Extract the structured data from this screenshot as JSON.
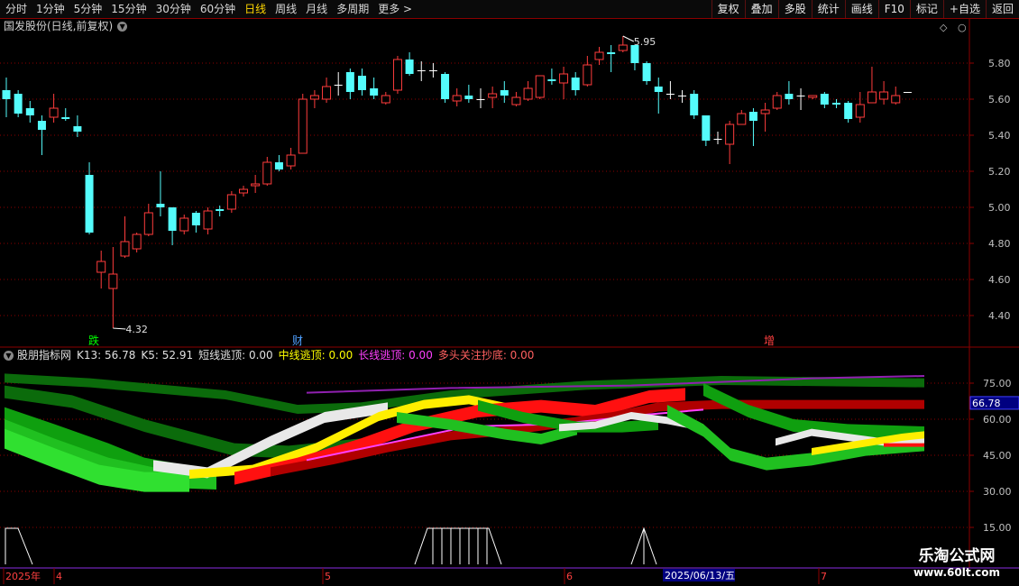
{
  "toolbar": {
    "periods": [
      {
        "label": "分时",
        "active": false
      },
      {
        "label": "1分钟",
        "active": false
      },
      {
        "label": "5分钟",
        "active": false
      },
      {
        "label": "15分钟",
        "active": false
      },
      {
        "label": "30分钟",
        "active": false
      },
      {
        "label": "60分钟",
        "active": false
      },
      {
        "label": "日线",
        "active": true
      },
      {
        "label": "周线",
        "active": false
      },
      {
        "label": "月线",
        "active": false
      },
      {
        "label": "多周期",
        "active": false
      },
      {
        "label": "更多",
        "active": false
      }
    ],
    "actions": [
      "复权",
      "叠加",
      "多股",
      "统计",
      "画线",
      "F10",
      "标记",
      "+自选",
      "返回"
    ]
  },
  "main_chart": {
    "title": "国发股份(日线,前复权)",
    "y_ticks": [
      "5.80",
      "5.60",
      "5.40",
      "5.20",
      "5.00",
      "4.80",
      "4.60",
      "4.40"
    ],
    "high_label": "5.95",
    "low_label": "4.32",
    "markers": [
      {
        "text": "跌",
        "color": "#00ff00"
      },
      {
        "text": "财",
        "color": "#4fa0ff"
      },
      {
        "text": "增",
        "color": "#ff4040"
      }
    ],
    "candles": [
      [
        5.65,
        5.6,
        5.72,
        5.5
      ],
      [
        5.63,
        5.52,
        5.65,
        5.5
      ],
      [
        5.55,
        5.51,
        5.59,
        5.47
      ],
      [
        5.48,
        5.43,
        5.51,
        5.29
      ],
      [
        5.5,
        5.55,
        5.63,
        5.47
      ],
      [
        5.5,
        5.49,
        5.55,
        5.48
      ],
      [
        5.45,
        5.42,
        5.51,
        5.39
      ],
      [
        5.18,
        4.86,
        5.25,
        4.85
      ],
      [
        4.64,
        4.7,
        4.76,
        4.55
      ],
      [
        4.55,
        4.63,
        4.78,
        4.33
      ],
      [
        4.73,
        4.81,
        4.95,
        4.72
      ],
      [
        4.77,
        4.85,
        4.86,
        4.75
      ],
      [
        4.85,
        4.97,
        5.02,
        4.84
      ],
      [
        5.02,
        5.0,
        5.2,
        4.95
      ],
      [
        5.0,
        4.87,
        5.0,
        4.79
      ],
      [
        4.87,
        4.94,
        4.96,
        4.85
      ],
      [
        4.97,
        4.9,
        4.98,
        4.86
      ],
      [
        4.88,
        4.98,
        5.0,
        4.85
      ],
      [
        4.99,
        4.98,
        5.01,
        4.95
      ],
      [
        4.99,
        5.07,
        5.09,
        4.97
      ],
      [
        5.08,
        5.1,
        5.12,
        5.06
      ],
      [
        5.12,
        5.13,
        5.18,
        5.08
      ],
      [
        5.13,
        5.25,
        5.28,
        5.12
      ],
      [
        5.25,
        5.21,
        5.29,
        5.2
      ],
      [
        5.23,
        5.29,
        5.33,
        5.21
      ],
      [
        5.3,
        5.6,
        5.63,
        5.3
      ],
      [
        5.6,
        5.62,
        5.65,
        5.55
      ],
      [
        5.6,
        5.67,
        5.72,
        5.58
      ],
      [
        5.68,
        5.68,
        5.75,
        5.62
      ],
      [
        5.75,
        5.64,
        5.77,
        5.6
      ],
      [
        5.73,
        5.65,
        5.77,
        5.62
      ],
      [
        5.66,
        5.62,
        5.72,
        5.6
      ],
      [
        5.58,
        5.62,
        5.64,
        5.57
      ],
      [
        5.65,
        5.82,
        5.84,
        5.63
      ],
      [
        5.82,
        5.74,
        5.86,
        5.73
      ],
      [
        5.76,
        5.76,
        5.81,
        5.7
      ],
      [
        5.76,
        5.76,
        5.8,
        5.72
      ],
      [
        5.74,
        5.6,
        5.75,
        5.58
      ],
      [
        5.59,
        5.62,
        5.66,
        5.56
      ],
      [
        5.62,
        5.6,
        5.68,
        5.58
      ],
      [
        5.6,
        5.6,
        5.66,
        5.55
      ],
      [
        5.61,
        5.63,
        5.67,
        5.55
      ],
      [
        5.65,
        5.62,
        5.7,
        5.58
      ],
      [
        5.57,
        5.61,
        5.64,
        5.56
      ],
      [
        5.6,
        5.66,
        5.7,
        5.59
      ],
      [
        5.61,
        5.73,
        5.73,
        5.6
      ],
      [
        5.71,
        5.7,
        5.77,
        5.68
      ],
      [
        5.69,
        5.74,
        5.78,
        5.6
      ],
      [
        5.72,
        5.65,
        5.75,
        5.62
      ],
      [
        5.68,
        5.79,
        5.84,
        5.67
      ],
      [
        5.82,
        5.86,
        5.89,
        5.79
      ],
      [
        5.86,
        5.85,
        5.9,
        5.75
      ],
      [
        5.87,
        5.9,
        5.95,
        5.86
      ],
      [
        5.9,
        5.8,
        5.9,
        5.76
      ],
      [
        5.8,
        5.7,
        5.81,
        5.68
      ],
      [
        5.67,
        5.64,
        5.72,
        5.52
      ],
      [
        5.63,
        5.63,
        5.7,
        5.6
      ],
      [
        5.62,
        5.62,
        5.65,
        5.58
      ],
      [
        5.63,
        5.51,
        5.65,
        5.49
      ],
      [
        5.51,
        5.37,
        5.51,
        5.34
      ],
      [
        5.38,
        5.38,
        5.42,
        5.35
      ],
      [
        5.35,
        5.46,
        5.48,
        5.24
      ],
      [
        5.46,
        5.52,
        5.54,
        5.46
      ],
      [
        5.53,
        5.48,
        5.55,
        5.34
      ],
      [
        5.52,
        5.54,
        5.58,
        5.42
      ],
      [
        5.55,
        5.62,
        5.64,
        5.54
      ],
      [
        5.63,
        5.6,
        5.7,
        5.57
      ],
      [
        5.62,
        5.62,
        5.66,
        5.54
      ],
      [
        5.61,
        5.62,
        5.62,
        5.6
      ],
      [
        5.63,
        5.57,
        5.64,
        5.55
      ],
      [
        5.58,
        5.57,
        5.6,
        5.55
      ],
      [
        5.58,
        5.49,
        5.59,
        5.47
      ],
      [
        5.5,
        5.57,
        5.64,
        5.47
      ],
      [
        5.58,
        5.64,
        5.78,
        5.58
      ],
      [
        5.6,
        5.64,
        5.7,
        5.57
      ],
      [
        5.58,
        5.62,
        5.67,
        5.57
      ],
      [
        5.64,
        5.64,
        5.64,
        5.64
      ]
    ]
  },
  "indicator": {
    "name": "股朋指标网",
    "params": [
      {
        "text": "K13: 56.78",
        "color": "#e0e0e0"
      },
      {
        "text": "K5: 52.91",
        "color": "#e0e0e0"
      },
      {
        "text": "短线逃顶: 0.00",
        "color": "#e0e0e0"
      },
      {
        "text": "中线逃顶: 0.00",
        "color": "#ffff00"
      },
      {
        "text": "长线逃顶: 0.00",
        "color": "#ff40ff"
      },
      {
        "text": "多头关注抄底: 0.00",
        "color": "#ff6060"
      }
    ],
    "y_ticks": [
      "75.00",
      "60.00",
      "45.00",
      "30.00",
      "15.00"
    ],
    "current_value": "66.78"
  },
  "time_axis": {
    "labels": [
      "2025年",
      "4",
      "5",
      "6",
      "7"
    ],
    "cursor_date": "2025/06/13/五"
  },
  "watermark": {
    "line1": "乐淘公式网",
    "line2": "www.60lt.com"
  },
  "colors": {
    "up": "#ff3c3c",
    "down": "#54fcfc",
    "grid": "#8b0000",
    "axis_text": "#c0c0c0"
  }
}
